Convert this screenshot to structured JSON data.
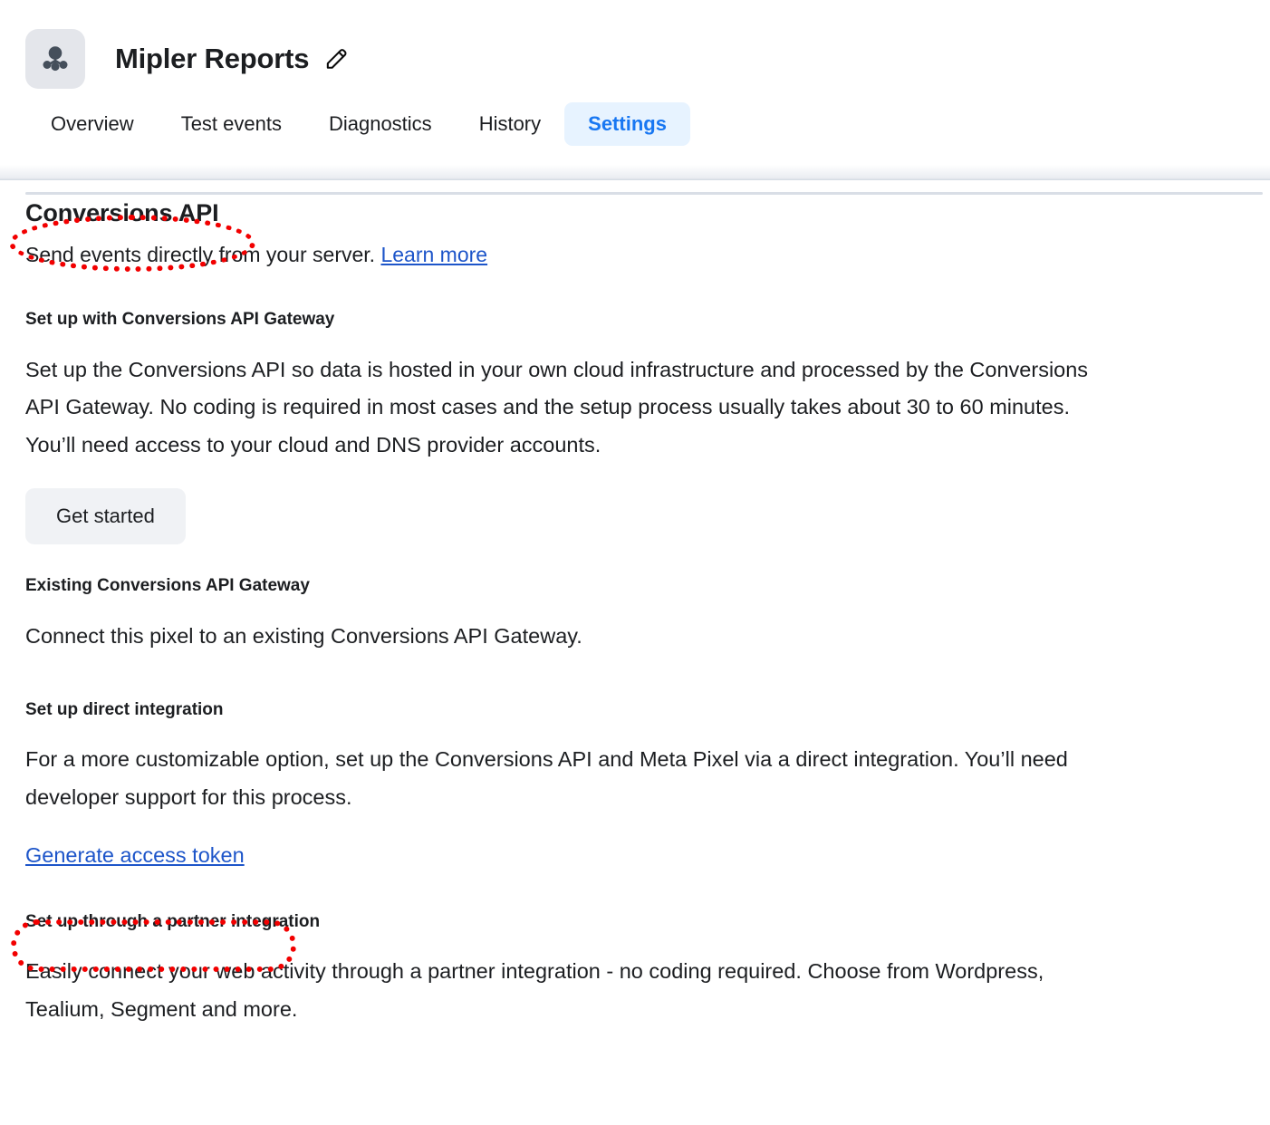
{
  "header": {
    "pixel_icon": "meta-pixel-icon",
    "title": "Mipler Reports",
    "edit_icon": "pencil-edit-icon",
    "tabs": [
      {
        "label": "Overview",
        "active": false
      },
      {
        "label": "Test events",
        "active": false
      },
      {
        "label": "Diagnostics",
        "active": false
      },
      {
        "label": "History",
        "active": false
      },
      {
        "label": "Settings",
        "active": true
      }
    ]
  },
  "main": {
    "section_title": "Conversions API",
    "subtitle_text": "Send events directly from your server.",
    "subtitle_link": "Learn more",
    "blocks": [
      {
        "heading": "Set up with Conversions API Gateway",
        "body": "Set up the Conversions API so data is hosted in your own cloud infrastructure and processed by the Conversions API Gateway. No coding is required in most cases and the setup process usually takes about 30 to 60 minutes. You’ll need access to your cloud and DNS provider accounts.",
        "button": "Get started"
      },
      {
        "heading": "Existing Conversions API Gateway",
        "body": "Connect this pixel to an existing Conversions API Gateway."
      },
      {
        "heading": "Set up direct integration",
        "body": "For a more customizable option, set up the Conversions API and Meta Pixel via a direct integration. You’ll need developer support for this process.",
        "link": "Generate access token"
      },
      {
        "heading": "Set up through a partner integration",
        "body": "Easily connect your web activity through a partner integration - no coding required. Choose from Wordpress, Tealium, Segment and more."
      }
    ]
  },
  "annotations": [
    {
      "name": "conversions-api-title-highlight",
      "shape": "ellipse",
      "color": "#f20000"
    },
    {
      "name": "generate-access-token-highlight",
      "shape": "stadium",
      "color": "#f20000"
    }
  ],
  "colors": {
    "accent_blue": "#1877f2",
    "active_tab_bg": "#e7f3ff",
    "link_blue": "#1d55c9",
    "button_bg": "#f0f2f5",
    "annotation_red": "#f20000",
    "text_primary": "#1c1e21",
    "badge_bg": "#e4e6eb"
  }
}
